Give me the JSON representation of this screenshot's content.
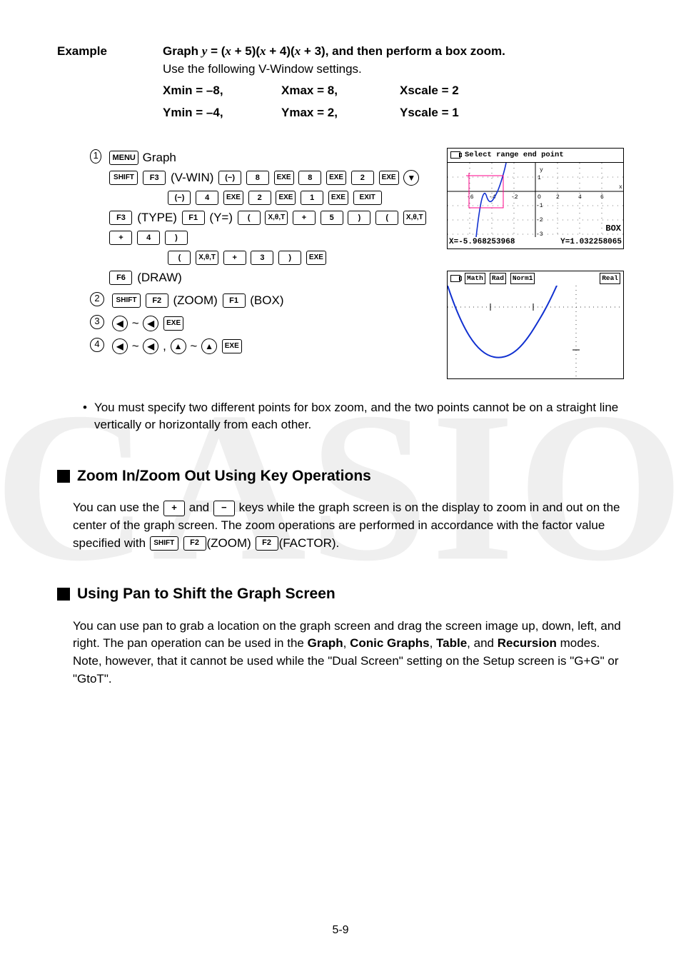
{
  "watermark": "CASIO",
  "example": {
    "label": "Example",
    "line1_a": "Graph ",
    "line1_b": "y",
    "line1_c": " = (",
    "line1_d": "x",
    "line1_e": " + 5)(",
    "line1_f": "x",
    "line1_g": " + 4)(",
    "line1_h": "x",
    "line1_i": " + 3), and then perform a box zoom.",
    "line2": "Use the following V-Window settings.",
    "vw": {
      "xmin": "Xmin = –8,",
      "xmax": "Xmax = 8,",
      "xscale": "Xscale = 2",
      "ymin": "Ymin = –4,",
      "ymax": "Ymax = 2,",
      "yscale": "Yscale = 1"
    }
  },
  "steps": {
    "n1": "1",
    "n2": "2",
    "n3": "3",
    "n4": "4",
    "graph_word": " Graph",
    "vwin_label": "(V-WIN)",
    "type_label": "(TYPE)",
    "yeq_label": "(Y=)",
    "draw_label": "(DRAW)",
    "zoom_label": "(ZOOM)",
    "box_label": "(BOX)",
    "tilde": "~",
    "comma": ","
  },
  "keys": {
    "menu": "MENU",
    "shift": "SHIFT",
    "f1": "F1",
    "f2": "F2",
    "f3": "F3",
    "f6": "F6",
    "neg": "(−)",
    "n1": "1",
    "n2": "2",
    "n3": "3",
    "n4": "4",
    "n5": "5",
    "n8": "8",
    "exe": "EXE",
    "exit": "EXIT",
    "down": "▼",
    "up": "▲",
    "left": "◀",
    "lp": "(",
    "rp": ")",
    "xot": "X,θ,T",
    "plus": "+",
    "minus": "−"
  },
  "lcd1": {
    "title": "Select range end point",
    "boxtag": "BOX",
    "xval": "X=-5.968253968",
    "yval": "Y=1.032258065"
  },
  "lcd2": {
    "h1": "Math",
    "h2": "Rad",
    "h3": "Norm1",
    "h4": "Real"
  },
  "note": {
    "bullet": "•",
    "text": "You must specify two different points for box zoom, and the two points cannot be on a straight line vertically or horizontally from each other."
  },
  "sec1": {
    "title": "Zoom In/Zoom Out Using Key Operations",
    "t1": "You can use the ",
    "t2": " and ",
    "t3": " keys while the graph screen is on the display to zoom in and out on the center of the graph screen. The zoom operations are performed in accordance with the factor value specified with ",
    "zoom": "(ZOOM)",
    "factor": "(FACTOR).",
    "kp": "+",
    "km": "−"
  },
  "sec2": {
    "title": "Using Pan to Shift the Graph Screen",
    "p1": "You can use pan to grab a location on the graph screen and drag the screen image up, down, left, and right. The pan operation can be used in the ",
    "b1": "Graph",
    "p2": ", ",
    "b2": "Conic Graphs",
    "p3": ", ",
    "b3": "Table",
    "p4": ", and ",
    "b4": "Recursion",
    "p5": " modes. Note, however, that it cannot be used while the \"Dual Screen\" setting on the Setup screen is \"G+G\" or \"GtoT\"."
  },
  "pagenum": "5-9"
}
